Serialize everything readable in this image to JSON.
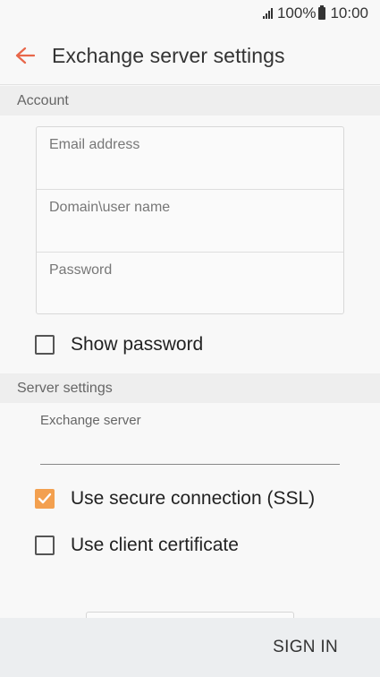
{
  "status_bar": {
    "battery": "100%",
    "time": "10:00"
  },
  "header": {
    "title": "Exchange server settings"
  },
  "sections": {
    "account": "Account",
    "server_settings": "Server settings"
  },
  "account_fields": {
    "email_placeholder": "Email address",
    "domain_user_placeholder": "Domain\\user name",
    "password_placeholder": "Password"
  },
  "show_password": {
    "label": "Show password",
    "checked": false
  },
  "server": {
    "label": "Exchange server",
    "value": ""
  },
  "ssl": {
    "label": "Use secure connection (SSL)",
    "checked": true
  },
  "client_certificate": {
    "label": "Use client certificate",
    "checked": false
  },
  "footer": {
    "sign_in": "SIGN IN"
  },
  "colors": {
    "accent": "#f3a04f",
    "back_arrow": "#e8674a"
  }
}
